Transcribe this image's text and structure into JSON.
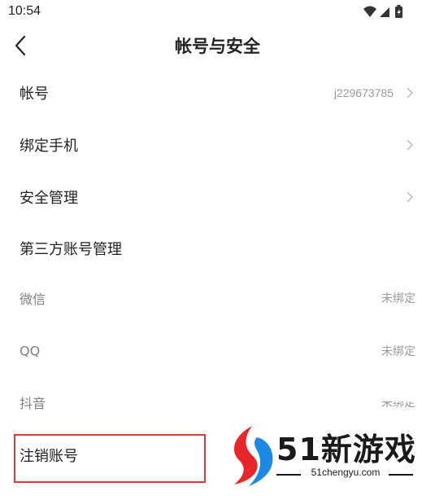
{
  "status_bar": {
    "time": "10:54",
    "icons": [
      "wifi-icon",
      "signal-icon",
      "battery-icon"
    ]
  },
  "header": {
    "title": "帐号与安全",
    "back_icon": "chevron-left-icon"
  },
  "rows": {
    "account": {
      "label": "帐号",
      "value": "j229673785"
    },
    "bind_phone": {
      "label": "绑定手机"
    },
    "security": {
      "label": "安全管理"
    }
  },
  "third_party": {
    "title": "第三方账号管理",
    "items": [
      {
        "label": "微信",
        "value": "未绑定"
      },
      {
        "label": "QQ",
        "value": "未绑定"
      },
      {
        "label": "抖音",
        "value": "未绑定"
      }
    ]
  },
  "cancel_account": {
    "label": "注销账号"
  },
  "watermark": {
    "brand": "51新游戏",
    "domain": "51chengyu.com"
  },
  "colors": {
    "highlight_border": "#e53935",
    "logo_red": "#e8262a",
    "logo_blue": "#1e88e5",
    "secondary_text": "#9a9a9a"
  }
}
